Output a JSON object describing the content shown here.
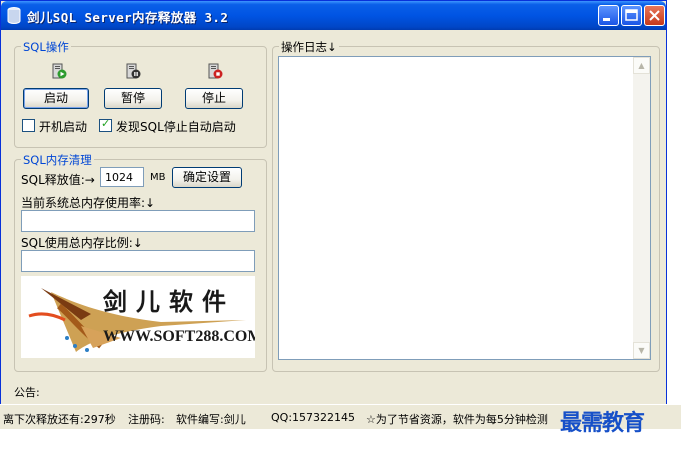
{
  "window": {
    "title": "剑儿SQL Server内存释放器 3.2",
    "controls": [
      "minimize-icon",
      "maximize-icon",
      "close-icon"
    ]
  },
  "sql_ops": {
    "group_label": "SQL操作",
    "start_label": "启动",
    "pause_label": "暂停",
    "stop_label": "停止",
    "autostart_label": "开机启动",
    "autostart_checked": false,
    "auto_restart_label": "发现SQL停止自动启动",
    "auto_restart_checked": true,
    "check_mark": "✓"
  },
  "memory": {
    "group_label": "SQL内存清理",
    "release_label": "SQL释放值:→",
    "release_value": "1024",
    "unit": "MB",
    "confirm_label": "确定设置",
    "system_usage_label": "当前系统总内存使用率:↓",
    "sql_ratio_label": "SQL使用总内存比例:↓"
  },
  "banner": {
    "title": "剑儿软件",
    "url": "WWW.SOFT288.COM"
  },
  "log": {
    "group_label": "操作日志↓",
    "scroll_up": "▲",
    "scroll_down": "▼"
  },
  "notice_label": "公告:",
  "status": {
    "next_release": "离下次释放还有:297秒",
    "register": "注册码:",
    "author": "软件编写:剑儿",
    "qq": "QQ:157322145",
    "tip": "☆为了节省资源，软件为每5分钟检测"
  },
  "watermark": "最需教育",
  "colors": {
    "titlebar": "#0054e3",
    "window_bg": "#ece9d8",
    "group_label": "#0046d5",
    "watermark": "#1650c8"
  }
}
